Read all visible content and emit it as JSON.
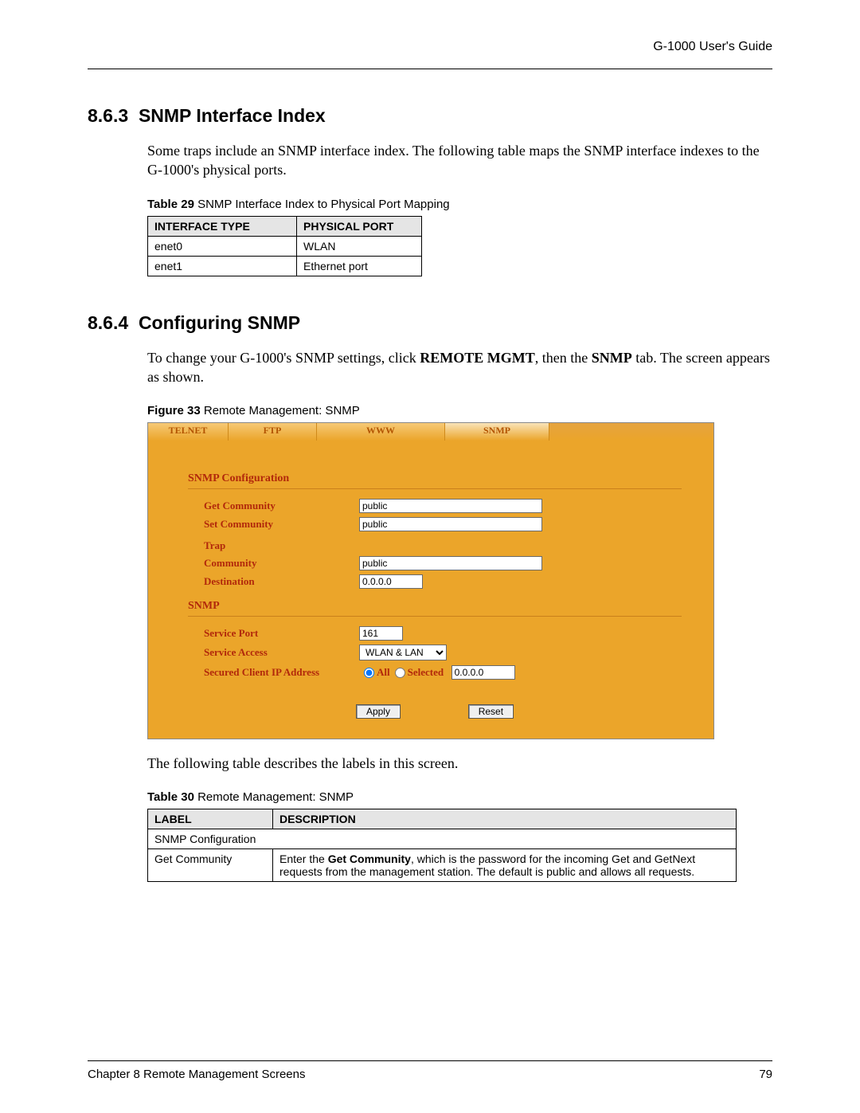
{
  "header": {
    "right": "G-1000 User's Guide"
  },
  "section1": {
    "num": "8.6.3",
    "title": "SNMP Interface Index",
    "para": "Some traps include an SNMP interface index. The following table maps the SNMP interface indexes to the G-1000's physical ports."
  },
  "table29": {
    "caption_bold": "Table 29",
    "caption_rest": "   SNMP Interface Index to Physical Port Mapping",
    "headers": [
      "INTERFACE TYPE",
      "PHYSICAL PORT"
    ],
    "rows": [
      [
        "enet0",
        "WLAN"
      ],
      [
        "enet1",
        "Ethernet port"
      ]
    ]
  },
  "section2": {
    "num": "8.6.4",
    "title": "Configuring SNMP",
    "para_pre": "To change your G-1000's SNMP settings, click ",
    "para_b1": "REMOTE MGMT",
    "para_mid": ", then the ",
    "para_b2": "SNMP",
    "para_post": " tab. The screen appears as shown."
  },
  "figure33": {
    "caption_bold": "Figure 33",
    "caption_rest": "   Remote Management: SNMP",
    "tabs": {
      "telnet": "TELNET",
      "ftp": "FTP",
      "www": "WWW",
      "snmp": "SNMP"
    },
    "group1": "SNMP Configuration",
    "labels": {
      "get_comm": "Get Community",
      "set_comm": "Set Community",
      "trap": "Trap",
      "community": "Community",
      "destination": "Destination"
    },
    "values": {
      "get_comm": "public",
      "set_comm": "public",
      "community": "public",
      "destination": "0.0.0.0"
    },
    "group2": "SNMP",
    "labels2": {
      "service_port": "Service Port",
      "service_access": "Service Access",
      "secured_ip": "Secured Client IP Address"
    },
    "values2": {
      "service_port": "161",
      "service_access": "WLAN & LAN",
      "radio_all": "All",
      "radio_selected": "Selected",
      "secured_ip": "0.0.0.0"
    },
    "buttons": {
      "apply": "Apply",
      "reset": "Reset"
    }
  },
  "after_figure": "The following table describes the labels in this screen.",
  "table30": {
    "caption_bold": "Table 30",
    "caption_rest": "   Remote Management: SNMP",
    "headers": [
      "LABEL",
      "DESCRIPTION"
    ],
    "row1": "SNMP Configuration",
    "row2_label": "Get Community",
    "row2_desc_pre": "Enter the ",
    "row2_desc_b": "Get Community",
    "row2_desc_post": ", which is the password for the incoming Get and GetNext requests from the management station. The default is public and allows all requests."
  },
  "footer": {
    "left": "Chapter 8 Remote Management Screens",
    "right": "79"
  }
}
